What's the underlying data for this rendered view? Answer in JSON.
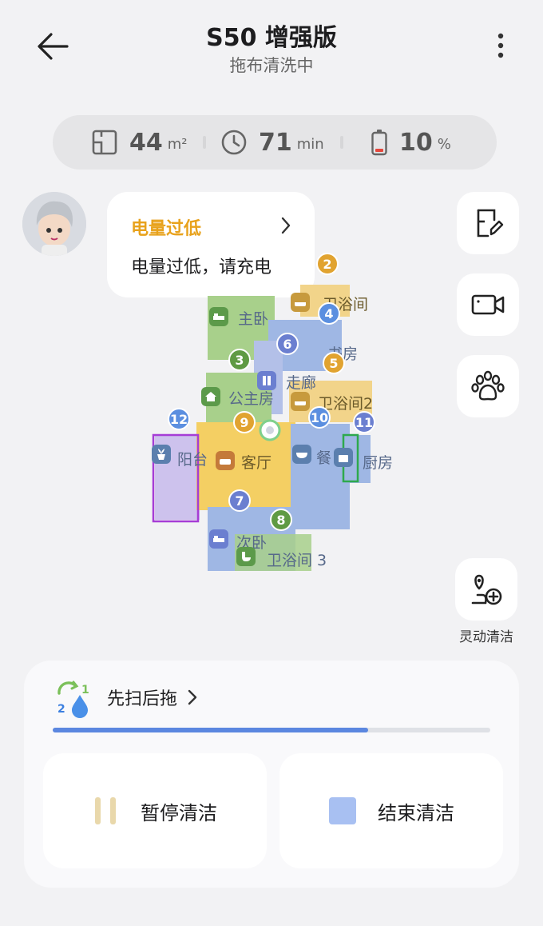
{
  "header": {
    "title": "S50 增强版",
    "status": "拖布清洗中"
  },
  "stats": {
    "area_value": "44",
    "area_unit": "m²",
    "time_value": "71",
    "time_unit": "min",
    "battery_value": "10",
    "battery_unit": "%"
  },
  "notification": {
    "title": "电量过低",
    "message": "电量过低，请充电"
  },
  "map": {
    "rooms": [
      "主卧",
      "书房",
      "走廊",
      "公主房",
      "卫浴间2",
      "阳台",
      "客厅",
      "餐",
      "厨房",
      "次卧",
      "卫浴间 3",
      "卫浴间"
    ],
    "pins": [
      "2",
      "3",
      "4",
      "5",
      "6",
      "7",
      "8",
      "9",
      "10",
      "11",
      "12"
    ]
  },
  "flex_clean": {
    "label": "灵动清洁"
  },
  "mode": {
    "label": "先扫后拖",
    "progress_fraction": 0.72
  },
  "actions": {
    "pause_label": "暂停清洁",
    "end_label": "结束清洁"
  }
}
